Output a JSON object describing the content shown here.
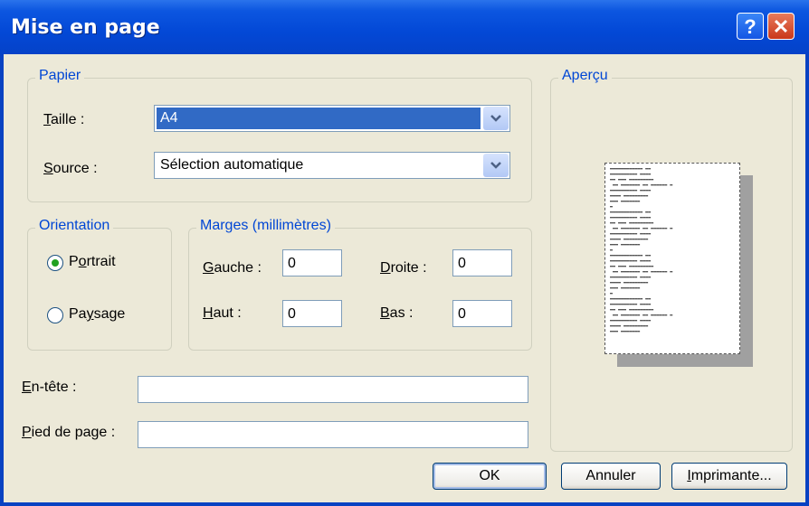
{
  "window": {
    "title": "Mise en page",
    "help_glyph": "?",
    "close_glyph": "✕"
  },
  "paper": {
    "legend": "Papier",
    "size_label_pre": "",
    "size_label_u": "T",
    "size_label_post": "aille :",
    "size_value": "A4",
    "source_label_u": "S",
    "source_label_post": "ource :",
    "source_value": "Sélection automatique"
  },
  "orientation": {
    "legend": "Orientation",
    "portrait_pre": "P",
    "portrait_u": "o",
    "portrait_post": "rtrait",
    "landscape_pre": "Pa",
    "landscape_u": "y",
    "landscape_post": "sage",
    "selected": "portrait"
  },
  "margins": {
    "legend": "Marges (millimètres)",
    "left_u": "G",
    "left_post": "auche :",
    "left_value": "0",
    "right_u": "D",
    "right_post": "roite :",
    "right_value": "0",
    "top_u": "H",
    "top_post": "aut :",
    "top_value": "0",
    "bottom_u": "B",
    "bottom_post": "as :",
    "bottom_value": "0"
  },
  "header": {
    "label_u": "E",
    "label_post": "n-tête :",
    "value": ""
  },
  "footer": {
    "label_u": "P",
    "label_post": "ied de page :",
    "value": ""
  },
  "preview": {
    "legend": "Aperçu"
  },
  "buttons": {
    "ok": "OK",
    "cancel": "Annuler",
    "printer_u": "I",
    "printer_post": "mprimante..."
  },
  "colors": {
    "accent": "#0046d5",
    "titlebar": "#0348d6",
    "selection": "#316ac5"
  }
}
